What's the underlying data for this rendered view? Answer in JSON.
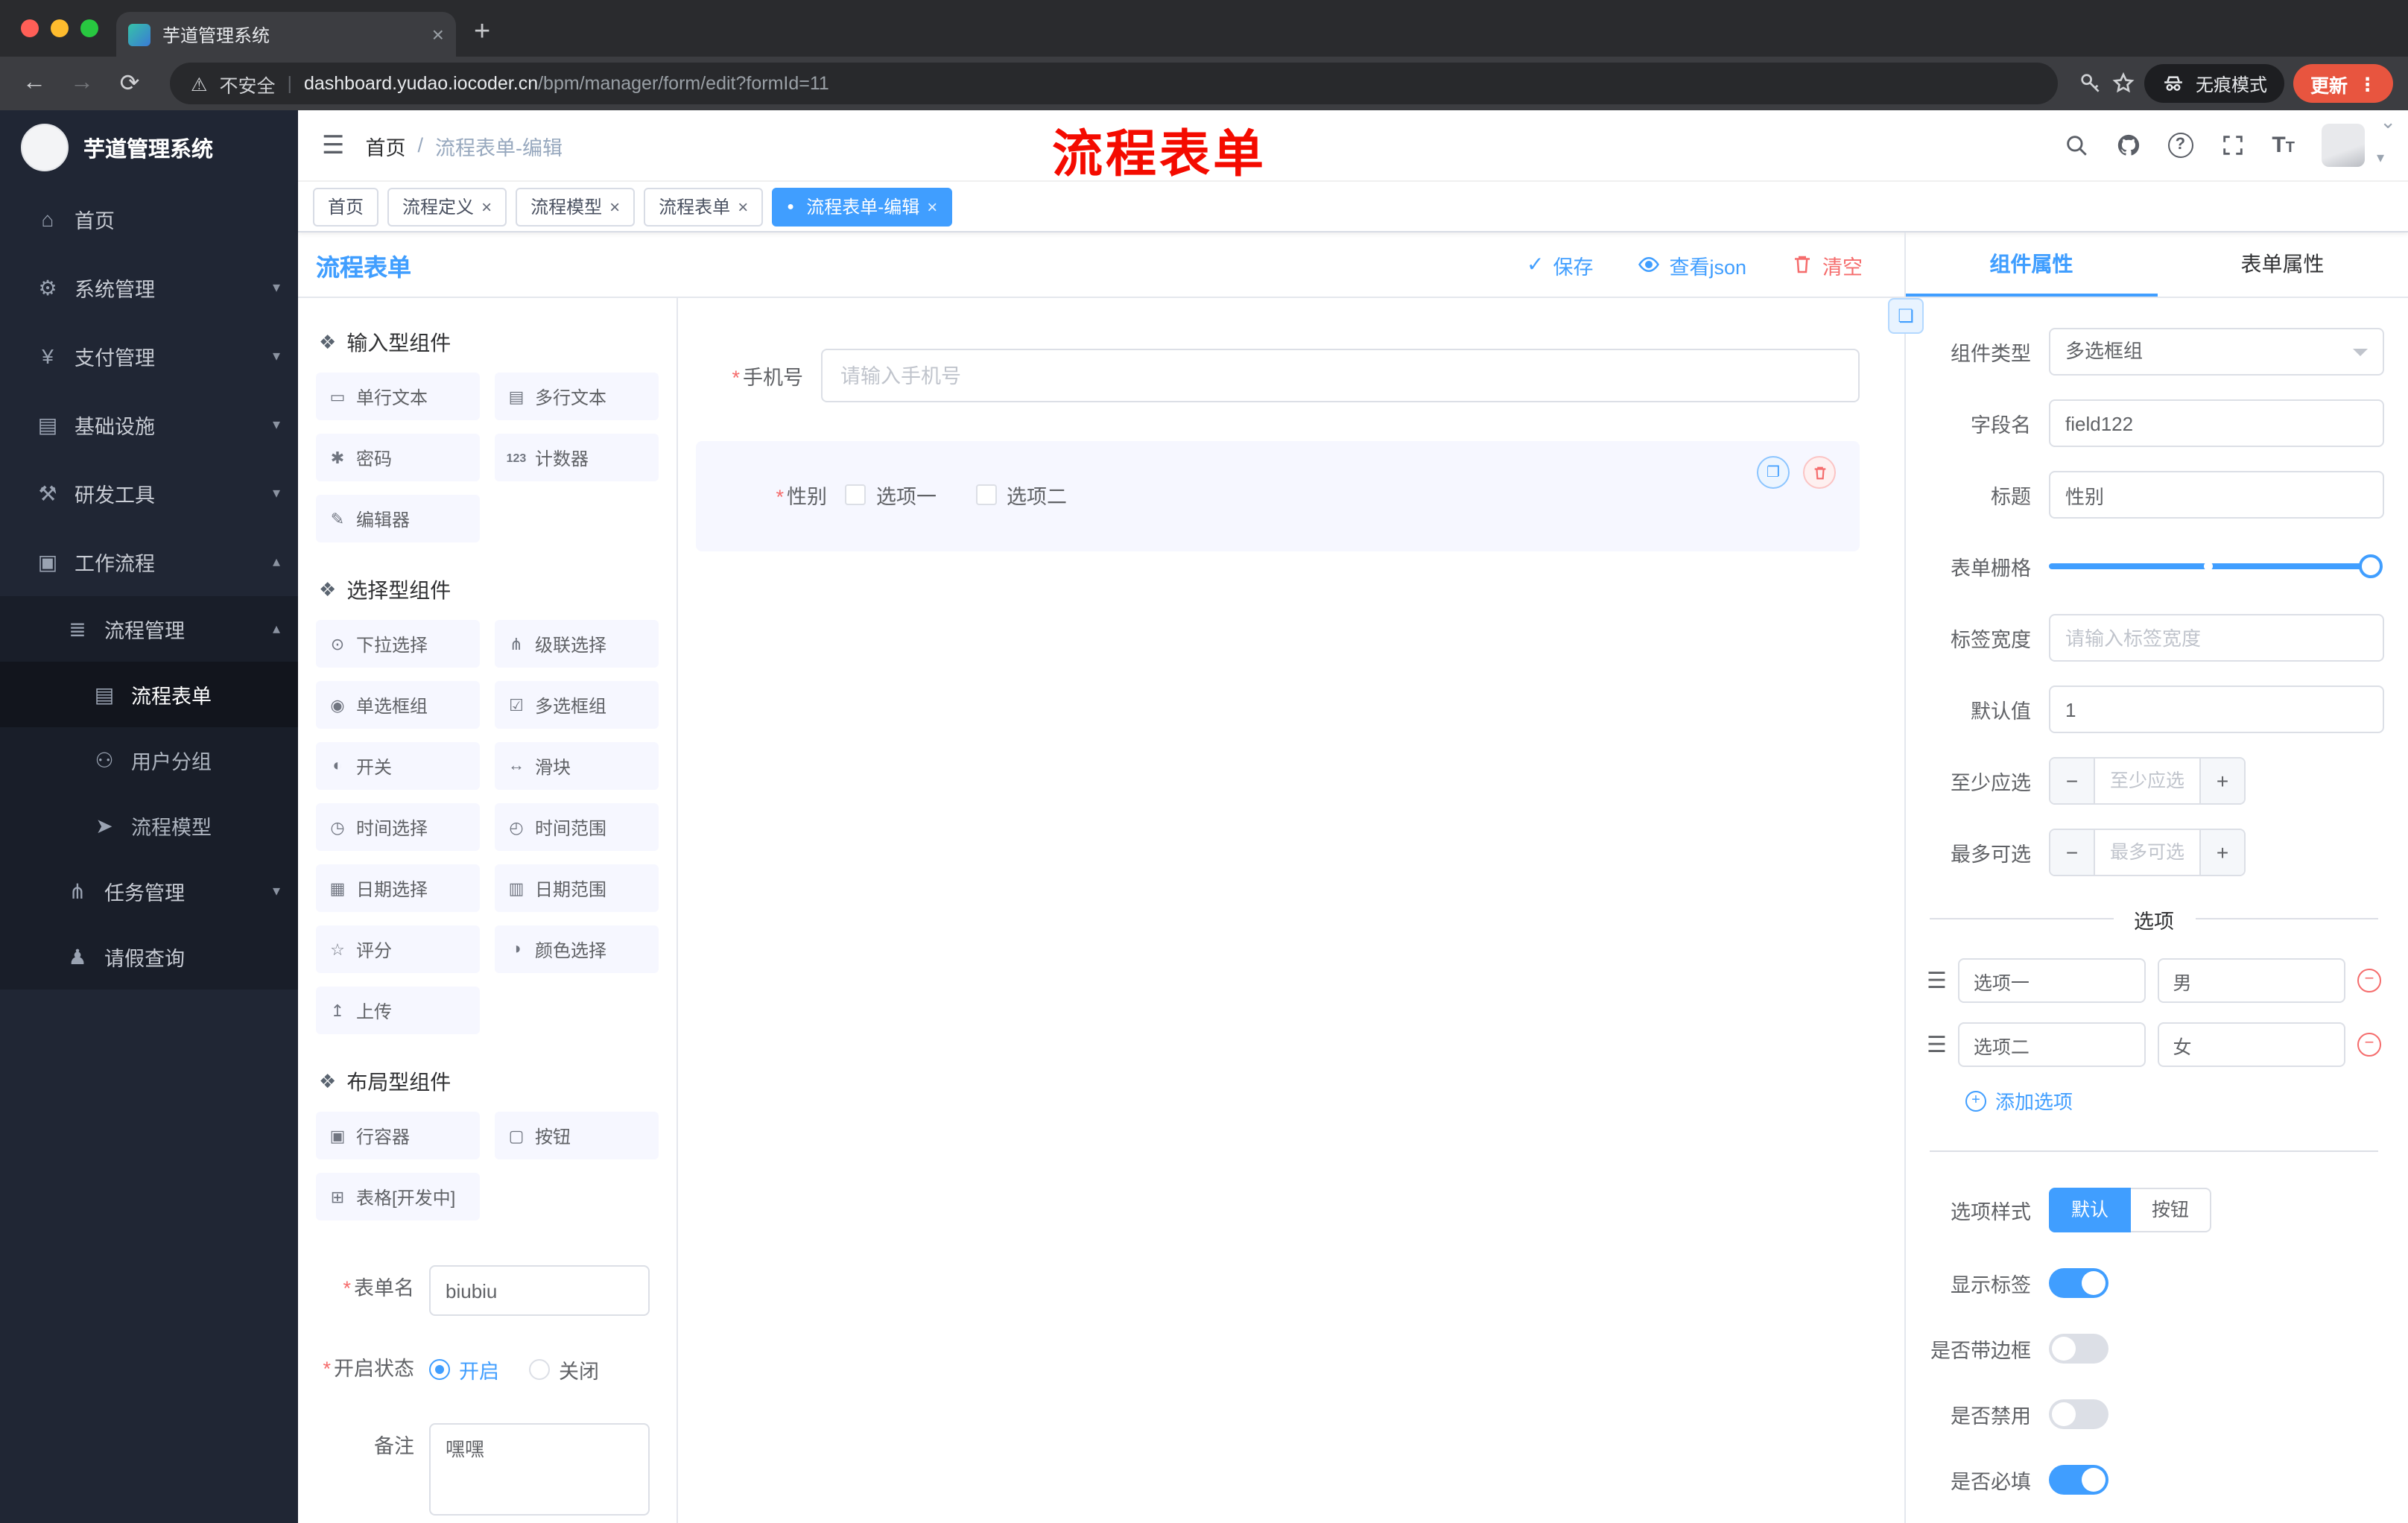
{
  "colors": {
    "primary": "#409eff",
    "danger": "#f56c6c",
    "update_chip": "#e8553f"
  },
  "icons": {
    "close": "×",
    "plus": "+",
    "minus": "−",
    "back": "←",
    "forward": "→",
    "reload": "⟳",
    "warning": "⚠",
    "divider": "|",
    "kebab": "⋮",
    "dot": "●",
    "hamburger": "☰",
    "question": "?",
    "font_size": "T",
    "check": "✓",
    "copy": "❐",
    "drag": "☰",
    "section": "❖",
    "link": "❏",
    "chevron_down": "⌄",
    "caret": "▾"
  },
  "common": {
    "required_mark": "*"
  },
  "browser": {
    "tab_title": "芋道管理系统",
    "security_label": "不安全",
    "url_domain": "dashboard.yudao.iocoder.cn",
    "url_path": "/bpm/manager/form/edit?formId=11",
    "incognito_label": "无痕模式",
    "update_label": "更新"
  },
  "annotation": {
    "text": "流程表单"
  },
  "sidebar": {
    "logo_title": "芋道管理系统",
    "items": [
      {
        "label": "首页",
        "icon": "⌂"
      },
      {
        "label": "系统管理",
        "icon": "⚙",
        "chevron": "▾"
      },
      {
        "label": "支付管理",
        "icon": "¥",
        "chevron": "▾"
      },
      {
        "label": "基础设施",
        "icon": "▤",
        "chevron": "▾"
      },
      {
        "label": "研发工具",
        "icon": "⚒",
        "chevron": "▾"
      },
      {
        "label": "工作流程",
        "icon": "▣",
        "chevron": "▴"
      },
      {
        "label": "流程管理",
        "icon": "≣",
        "chevron": "▴"
      },
      {
        "label": "流程表单",
        "icon": "▤"
      },
      {
        "label": "用户分组",
        "icon": "⚇"
      },
      {
        "label": "流程模型",
        "icon": "➤"
      },
      {
        "label": "任务管理",
        "icon": "⋔",
        "chevron": "▾"
      },
      {
        "label": "请假查询",
        "icon": "♟"
      }
    ]
  },
  "header": {
    "breadcrumb_root": "首页",
    "breadcrumb_sep": "/",
    "breadcrumb_current": "流程表单-编辑"
  },
  "tags": [
    {
      "label": "首页"
    },
    {
      "label": "流程定义"
    },
    {
      "label": "流程模型"
    },
    {
      "label": "流程表单"
    },
    {
      "label": "流程表单-编辑"
    }
  ],
  "designer": {
    "title": "流程表单",
    "save_label": "保存",
    "view_json_label": "查看json",
    "clear_label": "清空",
    "groups": [
      {
        "title": "输入型组件",
        "items": [
          {
            "icon": "▭",
            "label": "单行文本"
          },
          {
            "icon": "▤",
            "label": "多行文本"
          },
          {
            "icon": "✱",
            "label": "密码"
          },
          {
            "icon": "123",
            "label": "计数器"
          },
          {
            "icon": "✎",
            "label": "编辑器"
          }
        ]
      },
      {
        "title": "选择型组件",
        "items": [
          {
            "icon": "⊙",
            "label": "下拉选择"
          },
          {
            "icon": "⋔",
            "label": "级联选择"
          },
          {
            "icon": "◉",
            "label": "单选框组"
          },
          {
            "icon": "☑",
            "label": "多选框组"
          },
          {
            "icon": "◐",
            "label": "开关"
          },
          {
            "icon": "↔",
            "label": "滑块"
          },
          {
            "icon": "◷",
            "label": "时间选择"
          },
          {
            "icon": "◴",
            "label": "时间范围"
          },
          {
            "icon": "▦",
            "label": "日期选择"
          },
          {
            "icon": "▥",
            "label": "日期范围"
          },
          {
            "icon": "☆",
            "label": "评分"
          },
          {
            "icon": "◑",
            "label": "颜色选择"
          },
          {
            "icon": "↥",
            "label": "上传"
          }
        ]
      },
      {
        "title": "布局型组件",
        "items": [
          {
            "icon": "▣",
            "label": "行容器"
          },
          {
            "icon": "▢",
            "label": "按钮"
          },
          {
            "icon": "⊞",
            "label": "表格[开发中]"
          }
        ]
      }
    ],
    "meta": {
      "form_name_label": "表单名",
      "form_name_value": "biubiu",
      "status_label": "开启状态",
      "status_on": "开启",
      "status_off": "关闭",
      "remark_label": "备注",
      "remark_value": "嘿嘿"
    }
  },
  "canvas": {
    "phone_label": "手机号",
    "phone_placeholder": "请输入手机号",
    "gender_label": "性别",
    "gender_options": [
      {
        "label": "选项一"
      },
      {
        "label": "选项二"
      }
    ]
  },
  "properties": {
    "tab_component": "组件属性",
    "tab_form": "表单属性",
    "rows": {
      "type_label": "组件类型",
      "type_value": "多选框组",
      "field_label": "字段名",
      "field_value": "field122",
      "title_label": "标题",
      "title_value": "性别",
      "grid_label": "表单栅格",
      "label_width_label": "标签宽度",
      "label_width_placeholder": "请输入标签宽度",
      "default_label": "默认值",
      "default_value": "1",
      "min_label": "至少应选",
      "min_placeholder": "至少应选",
      "max_label": "最多可选",
      "max_placeholder": "最多可选"
    },
    "options_title": "选项",
    "options": [
      {
        "label": "选项一",
        "value": "男"
      },
      {
        "label": "选项二",
        "value": "女"
      }
    ],
    "add_option_label": "添加选项",
    "style_label": "选项样式",
    "style_default": "默认",
    "style_button": "按钮",
    "switch_rows": [
      {
        "label": "显示标签",
        "on": true
      },
      {
        "label": "是否带边框",
        "on": false
      },
      {
        "label": "是否禁用",
        "on": false
      },
      {
        "label": "是否必填",
        "on": true
      }
    ]
  }
}
